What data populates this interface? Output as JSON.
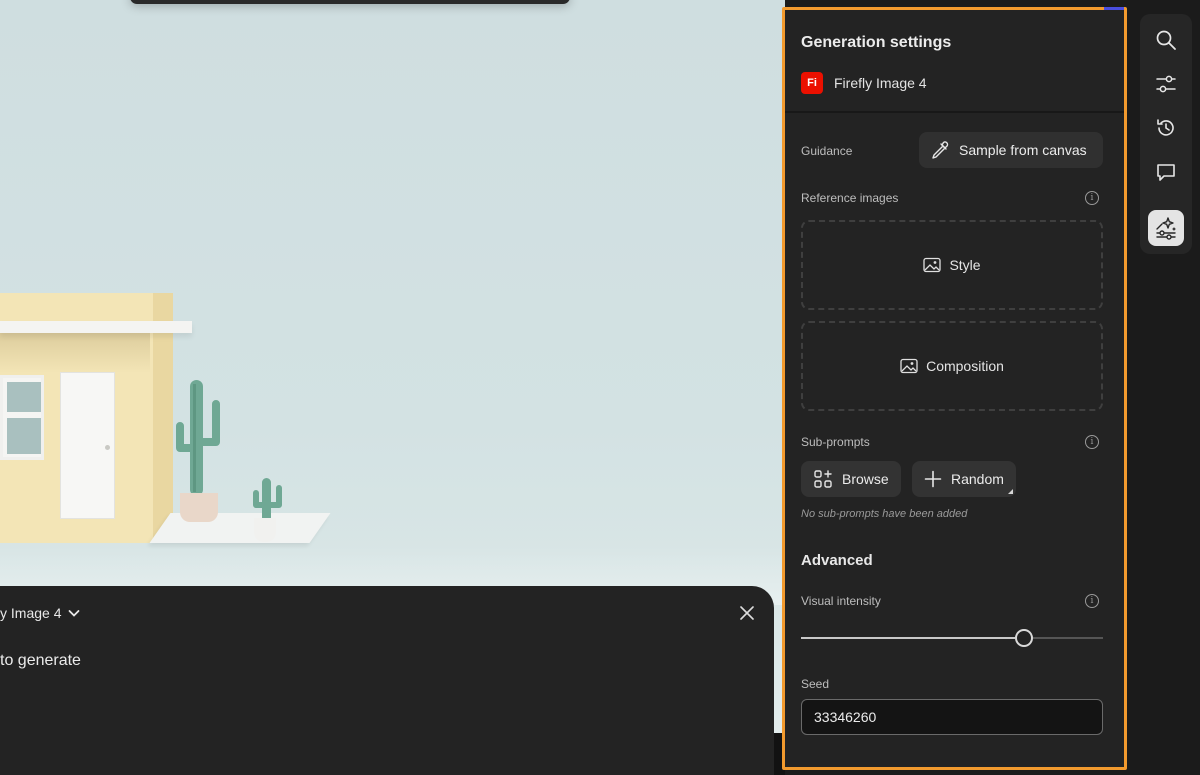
{
  "canvas": {
    "model_picker": {
      "label": "y Image 4"
    },
    "prompt_text": "to generate"
  },
  "settings": {
    "title": "Generation settings",
    "model": {
      "logo_text": "Fi",
      "name": "Firefly Image 4"
    },
    "guidance": {
      "label": "Guidance",
      "sample_button": "Sample from canvas"
    },
    "reference_images": {
      "label": "Reference images",
      "style_label": "Style",
      "composition_label": "Composition"
    },
    "sub_prompts": {
      "label": "Sub-prompts",
      "browse_label": "Browse",
      "random_label": "Random",
      "empty_note": "No sub-prompts have been added"
    },
    "advanced": {
      "heading": "Advanced",
      "visual_intensity": {
        "label": "Visual intensity",
        "value": 0.737
      },
      "seed": {
        "label": "Seed",
        "value": "33346260"
      }
    }
  },
  "toolbar": {
    "tools": [
      "search-icon",
      "adjustments-icon",
      "history-icon",
      "comment-icon",
      "generation-settings-icon"
    ],
    "active": "generation-settings-icon"
  },
  "colors": {
    "highlight_border": "#f29a2e",
    "panel_bg": "#232323",
    "firefly_red": "#eb1000"
  }
}
